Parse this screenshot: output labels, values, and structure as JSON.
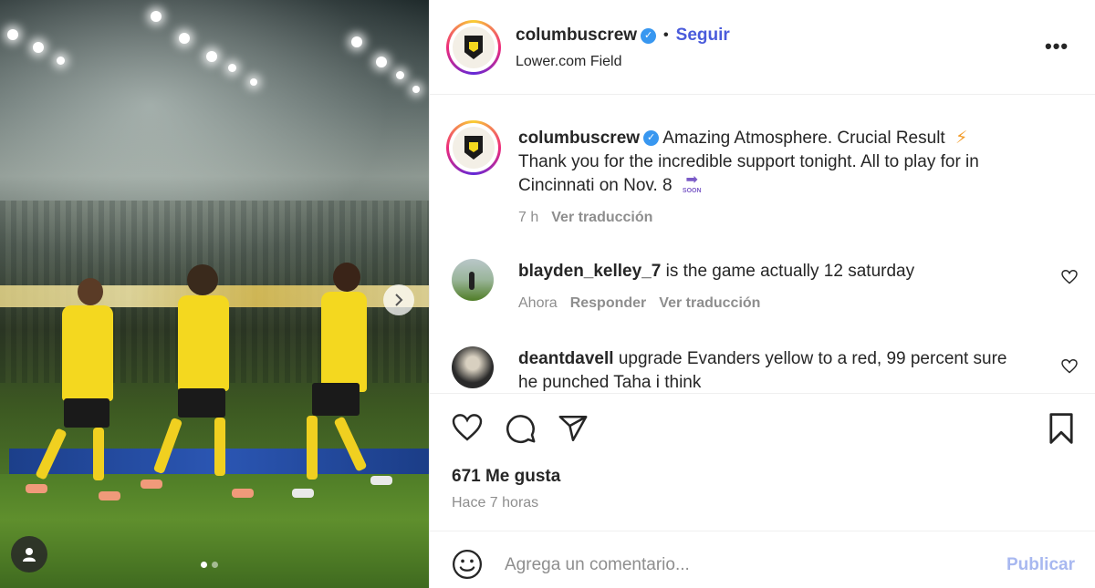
{
  "header": {
    "username": "columbuscrew",
    "separator": "•",
    "follow_label": "Seguir",
    "location": "Lower.com Field",
    "more_label": "•••"
  },
  "caption": {
    "username": "columbuscrew",
    "text_line1": "Amazing Atmosphere. Crucial Result",
    "text_line2": "Thank you for the incredible support tonight. All to play for in",
    "text_line3": "Cincinnati on Nov. 8",
    "soon_label": "SOON",
    "age": "7 h",
    "translate_label": "Ver traducción"
  },
  "comments": [
    {
      "username": "blayden_kelley_7",
      "text": "is the game actually 12 saturday",
      "age": "Ahora",
      "reply_label": "Responder",
      "translate_label": "Ver traducción"
    },
    {
      "username": "deantdavell",
      "text_line1": "upgrade Evanders yellow to a red, 99 percent sure",
      "text_line2": "he punched Taha i think"
    }
  ],
  "stats": {
    "likes": "671 Me gusta",
    "posted": "Hace 7 horas"
  },
  "add_comment": {
    "placeholder": "Agrega un comentario...",
    "publish_label": "Publicar"
  },
  "colors": {
    "verified": "#3897f0",
    "follow": "#4a5bdb",
    "publish_disabled": "#a8b8f0",
    "jersey": "#f4d81f"
  },
  "icons": [
    "chevron-right-icon",
    "user-tag-icon",
    "verified-icon",
    "more-icon",
    "heart-icon",
    "comment-icon",
    "share-icon",
    "bookmark-icon",
    "emoji-icon",
    "lightning-icon",
    "arrow-soon-icon"
  ],
  "carousel": {
    "total_slides": 2,
    "active_slide": 1
  }
}
